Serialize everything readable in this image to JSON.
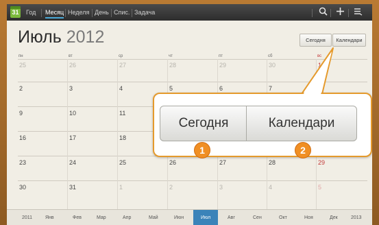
{
  "topbar": {
    "app_icon_day": "31",
    "tabs": [
      "Год",
      "Месяц",
      "Неделя",
      "День",
      "Спис.",
      "Задача"
    ],
    "active_tab": "Месяц"
  },
  "header": {
    "month": "Июль",
    "year": "2012",
    "today_button": "Сегодня",
    "calendars_button": "Календари"
  },
  "weekdays": [
    "пн",
    "вт",
    "ср",
    "чт",
    "пт",
    "сб",
    "вс"
  ],
  "weeks": [
    [
      "25",
      "26",
      "27",
      "28",
      "29",
      "30",
      "1"
    ],
    [
      "2",
      "3",
      "4",
      "5",
      "6",
      "7",
      ""
    ],
    [
      "9",
      "10",
      "11",
      "",
      "",
      "",
      ""
    ],
    [
      "16",
      "17",
      "18",
      "",
      "",
      "",
      ""
    ],
    [
      "23",
      "24",
      "25",
      "26",
      "27",
      "28",
      "29"
    ],
    [
      "30",
      "31",
      "1",
      "2",
      "3",
      "4",
      "5"
    ]
  ],
  "callout": {
    "today_button": "Сегодня",
    "calendars_button": "Календари",
    "badge1": "1",
    "badge2": "2"
  },
  "monthbar": {
    "items": [
      "2011",
      "Янв",
      "Фев",
      "Мар",
      "Апр",
      "Май",
      "Июн",
      "Июл",
      "Авг",
      "Сен",
      "Окт",
      "Ноя",
      "Дек",
      "2013"
    ],
    "selected": "Июл"
  },
  "colors": {
    "accent": "#f08f24",
    "selected_month": "#3b83b9",
    "sunday": "#c23a3a"
  }
}
